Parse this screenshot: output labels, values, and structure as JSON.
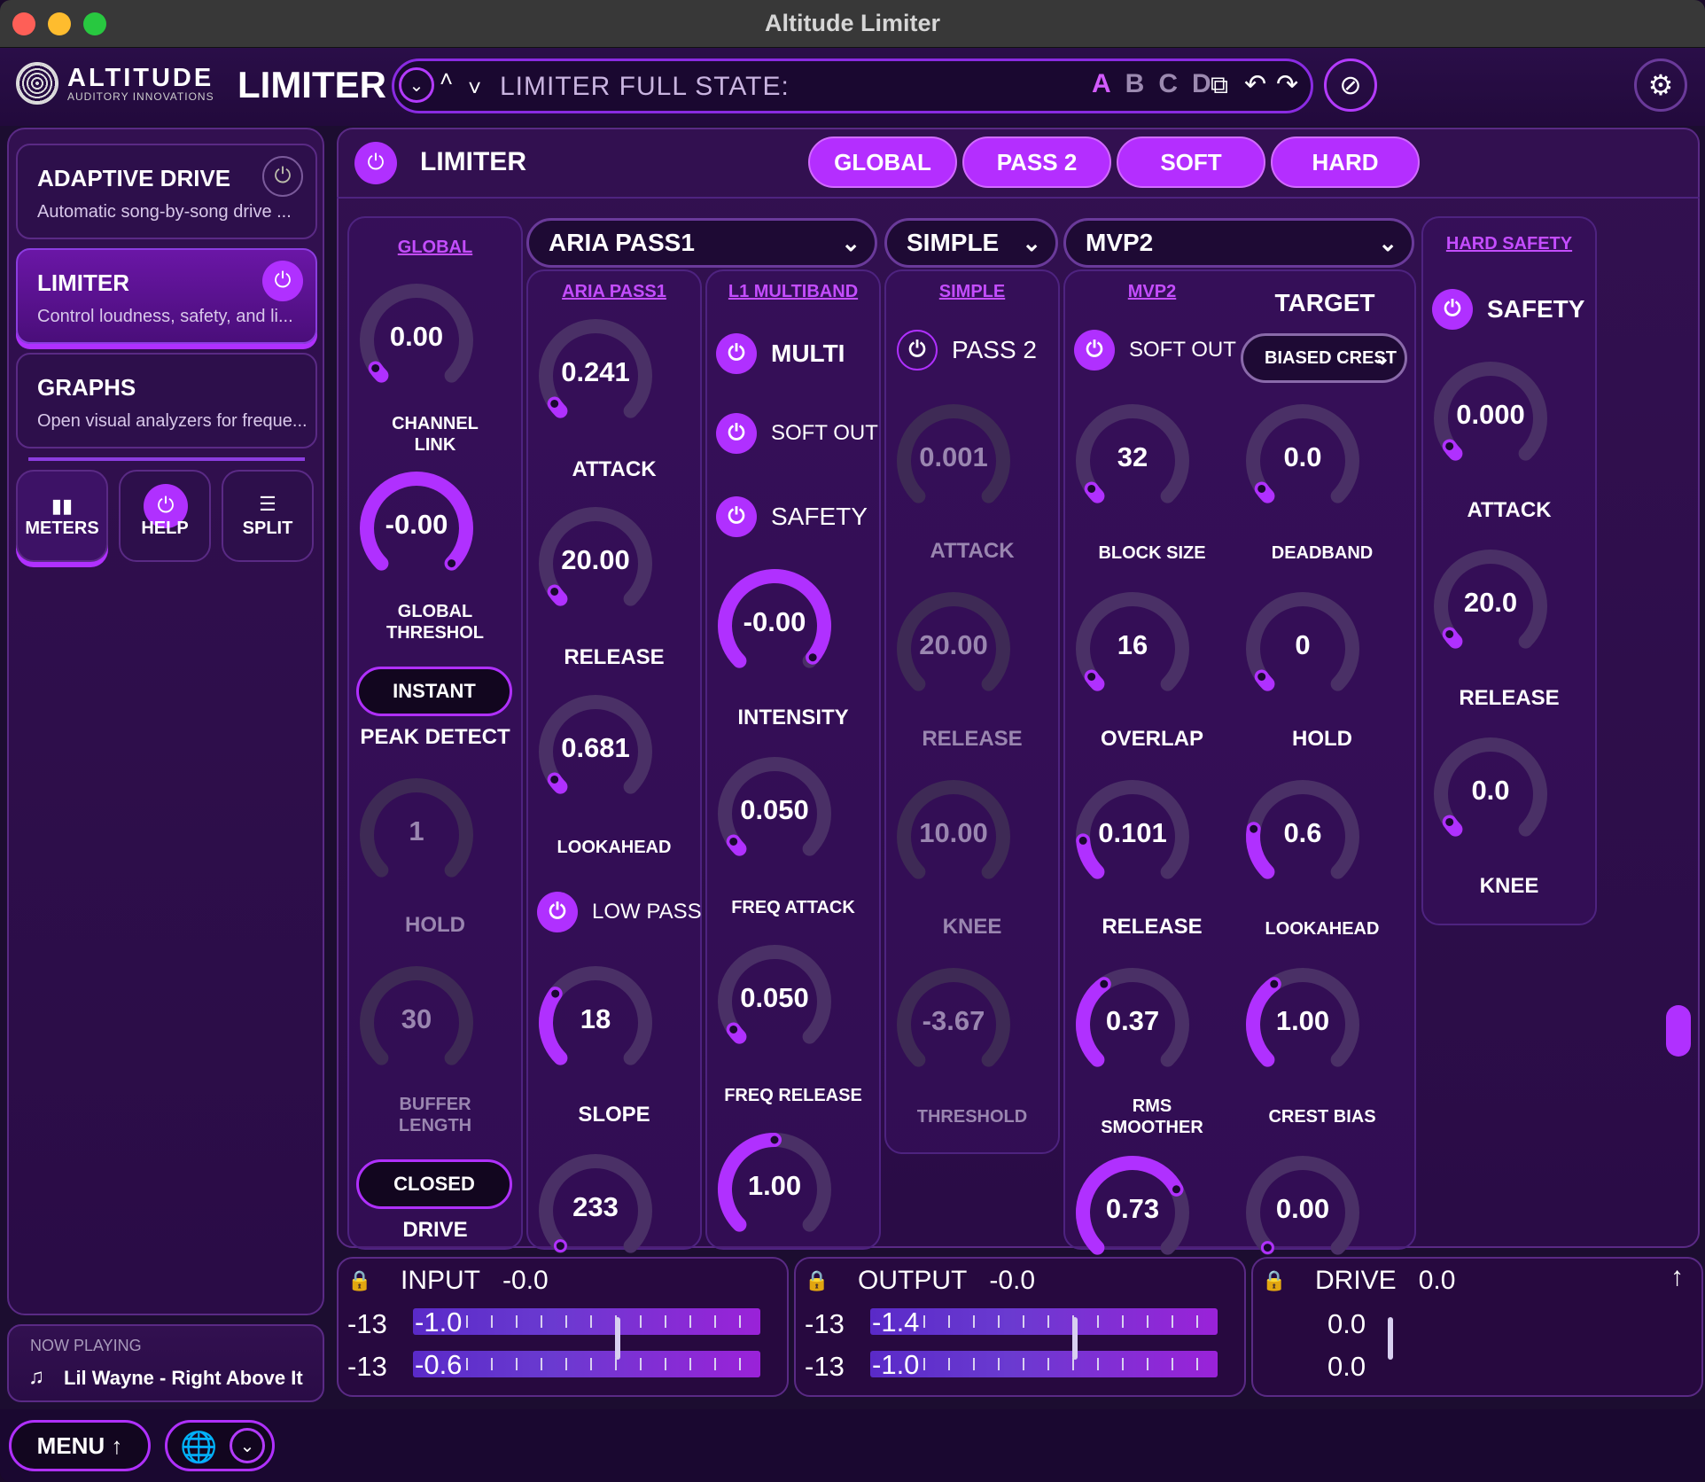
{
  "window": {
    "title": "Altitude Limiter"
  },
  "header": {
    "brand": "ALTITUDE",
    "brand_sub": "AUDITORY INNOVATIONS",
    "product": "LIMITER",
    "state_label": "LIMITER FULL STATE:",
    "slots": [
      "A",
      "B",
      "C",
      "D"
    ]
  },
  "sidebar": {
    "cards": [
      {
        "title": "ADAPTIVE DRIVE",
        "desc": "Automatic song-by-song drive ..."
      },
      {
        "title": "LIMITER",
        "desc": "Control loudness, safety, and li..."
      },
      {
        "title": "GRAPHS",
        "desc": "Open visual analyzers for freque..."
      }
    ],
    "buttons": [
      "METERS",
      "HELP",
      "SPLIT"
    ],
    "now_playing_label": "NOW PLAYING",
    "now_playing": "Lil Wayne - Right Above It"
  },
  "main": {
    "title": "LIMITER",
    "tabs": [
      "GLOBAL",
      "PASS 2",
      "SOFT",
      "HARD"
    ],
    "global": {
      "link": "GLOBAL",
      "channel_link": "0.00",
      "channel_link_label": "CHANNEL\nLINK",
      "threshold": "-0.00",
      "threshold_label": "GLOBAL\nTHRESHOL",
      "peak_mode": "INSTANT",
      "peak_label": "PEAK DETECT",
      "hold": "1",
      "hold_label": "HOLD",
      "buffer": "30",
      "buffer_label": "BUFFER\nLENGTH",
      "drive_mode": "CLOSED",
      "drive_label": "DRIVE"
    },
    "aria": {
      "dropdown": "ARIA PASS1",
      "link": "ARIA PASS1",
      "attack": "0.241",
      "attack_label": "ATTACK",
      "release": "20.00",
      "release_label": "RELEASE",
      "lookahead": "0.681",
      "lookahead_label": "LOOKAHEAD",
      "lowpass_label": "LOW PASS",
      "slope": "18",
      "slope_label": "SLOPE",
      "extra": "233"
    },
    "l1": {
      "link": "L1 MULTIBAND",
      "multi_label": "MULTI",
      "softout_label": "SOFT OUT",
      "safety_label": "SAFETY",
      "intensity": "-0.00",
      "intensity_label": "INTENSITY",
      "freq_attack": "0.050",
      "freq_attack_label": "FREQ ATTACK",
      "freq_release": "0.050",
      "freq_release_label": "FREQ RELEASE",
      "extra": "1.00"
    },
    "simple": {
      "dropdown": "SIMPLE",
      "link": "SIMPLE",
      "pass2_label": "PASS 2",
      "attack": "0.001",
      "attack_label": "ATTACK",
      "release": "20.00",
      "release_label": "RELEASE",
      "knee": "10.00",
      "knee_label": "KNEE",
      "threshold": "-3.67",
      "threshold_label": "THRESHOLD"
    },
    "mvp2": {
      "dropdown": "MVP2",
      "link": "MVP2",
      "target_label": "TARGET",
      "softout_label": "SOFT OUT",
      "target_mode": "BIASED CREST",
      "block_size": "32",
      "block_size_label": "BLOCK SIZE",
      "deadband": "0.0",
      "deadband_label": "DEADBAND",
      "overlap": "16",
      "overlap_label": "OVERLAP",
      "hold": "0",
      "hold_label": "HOLD",
      "release": "0.101",
      "release_label": "RELEASE",
      "lookahead": "0.6",
      "lookahead_label": "LOOKAHEAD",
      "rms": "0.37",
      "rms_label": "RMS\nSMOOTHER",
      "crest_bias": "1.00",
      "crest_bias_label": "CREST BIAS",
      "extra1": "0.73",
      "extra2": "0.00"
    },
    "hard": {
      "link": "HARD SAFETY",
      "safety_label": "SAFETY",
      "attack": "0.000",
      "attack_label": "ATTACK",
      "release": "20.0",
      "release_label": "RELEASE",
      "knee": "0.0",
      "knee_label": "KNEE"
    }
  },
  "meters": {
    "input": {
      "label": "INPUT",
      "value": "-0.0",
      "rows": [
        {
          "peak": "-13",
          "val": "-1.0"
        },
        {
          "peak": "-13",
          "val": "-0.6"
        }
      ]
    },
    "output": {
      "label": "OUTPUT",
      "value": "-0.0",
      "rows": [
        {
          "peak": "-13",
          "val": "-1.4"
        },
        {
          "peak": "-13",
          "val": "-1.0"
        }
      ]
    },
    "drive": {
      "label": "DRIVE",
      "value": "0.0",
      "rows": [
        {
          "val": "0.0"
        },
        {
          "val": "0.0"
        }
      ]
    }
  },
  "footer": {
    "menu": "MENU"
  },
  "colors": {
    "accent": "#b030ff",
    "bg": "#1c0d30",
    "panel": "#2d0f4b"
  }
}
